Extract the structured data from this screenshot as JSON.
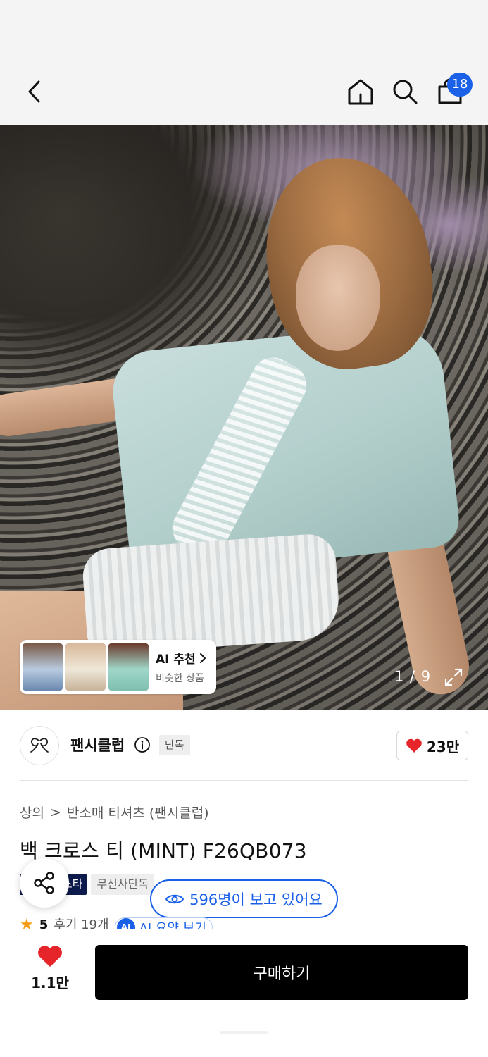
{
  "header": {
    "cart_count": "18"
  },
  "gallery": {
    "page_indicator": "1 / 9",
    "ai_recommend_label": "AI 추천",
    "ai_recommend_sub": "비슷한 상품"
  },
  "brand": {
    "name": "팬시클럽",
    "exclusive_badge": "단독",
    "likes": "23만"
  },
  "product": {
    "breadcrumb": [
      "상의",
      ">",
      "반소매 티셔츠 (팬시클럽)"
    ],
    "title": "백 크로스 티 (MINT) F26QB073",
    "tags": [
      "스타",
      "무신사단독"
    ],
    "viewers": "596명이 보고 있어요",
    "rating": "5",
    "reviews": "후기 19개",
    "ai_summary": "AI 요약 보기",
    "ai_badge": "AI"
  },
  "bottom": {
    "wish_count": "1.1만",
    "buy_label": "구매하기"
  },
  "colors": {
    "accent": "#1a61e8",
    "heart": "#e5252a",
    "buy_button": "#000000",
    "tag_dark": "#0d1b4c"
  }
}
